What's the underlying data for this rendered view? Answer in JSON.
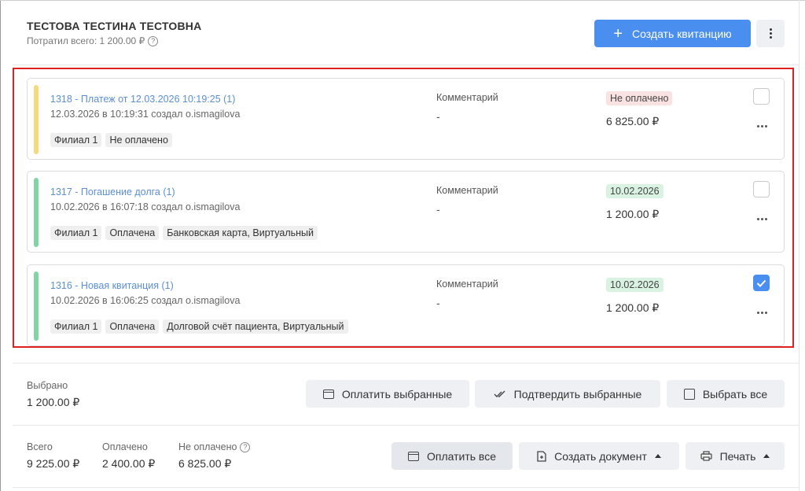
{
  "header": {
    "patient_name": "ТЕСТОВА ТЕСТИНА ТЕСТОВНА",
    "spent_label": "Потратил всего: 1 200.00 ₽",
    "create_button": "Создать квитанцию"
  },
  "bills": [
    {
      "title": "1318 - Платеж от 12.03.2026 10:19:25 (1)",
      "meta": "12.03.2026 в 10:19:31 создал o.ismagilova",
      "tags": [
        "Филиал 1",
        "Не оплачено"
      ],
      "comment_label": "Комментарий",
      "comment": "-",
      "status": "Не оплачено",
      "amount": "6 825.00 ₽",
      "checked": false,
      "stripe_color": "#f5d97a"
    },
    {
      "title": "1317 - Погашение долга (1)",
      "meta": "10.02.2026 в 16:07:18 создал o.ismagilova",
      "tags": [
        "Филиал 1",
        "Оплачена",
        "Банковская карта, Виртуальный"
      ],
      "comment_label": "Комментарий",
      "comment": "-",
      "status": "10.02.2026",
      "amount": "1 200.00 ₽",
      "checked": false,
      "stripe_color": "#7fd6a4"
    },
    {
      "title": "1316 - Новая квитанция (1)",
      "meta": "10.02.2026 в 16:06:25 создал o.ismagilova",
      "tags": [
        "Филиал 1",
        "Оплачена",
        "Долговой счёт пациента, Виртуальный"
      ],
      "comment_label": "Комментарий",
      "comment": "-",
      "status": "10.02.2026",
      "amount": "1 200.00 ₽",
      "checked": true,
      "stripe_color": "#7fd6a4"
    }
  ],
  "selection": {
    "label": "Выбрано",
    "value": "1 200.00 ₽",
    "pay_selected": "Оплатить выбранные",
    "confirm_selected": "Подтвердить выбранные",
    "select_all": "Выбрать все"
  },
  "totals": {
    "total_label": "Всего",
    "total_value": "9 225.00 ₽",
    "paid_label": "Оплачено",
    "paid_value": "2 400.00 ₽",
    "unpaid_label": "Не оплачено",
    "unpaid_value": "6 825.00 ₽",
    "pay_all": "Оплатить все",
    "create_document": "Создать документ",
    "print": "Печать"
  }
}
